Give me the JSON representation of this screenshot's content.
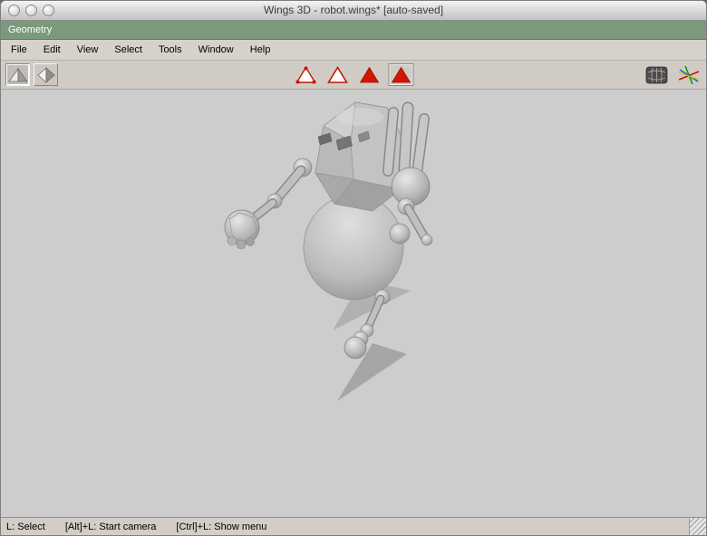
{
  "window": {
    "title": "Wings 3D - robot.wings* [auto-saved]",
    "controls": [
      "close",
      "minimize",
      "zoom"
    ]
  },
  "geometry_bar": {
    "label": "Geometry"
  },
  "menu": {
    "items": [
      "File",
      "Edit",
      "View",
      "Select",
      "Tools",
      "Window",
      "Help"
    ]
  },
  "toolbar": {
    "left_icons": [
      "flat-shaded-cone-icon",
      "smooth-shaded-cone-icon"
    ],
    "selection_icons": [
      "vertex-select-icon",
      "edge-select-icon",
      "face-select-icon",
      "body-select-icon"
    ],
    "active_selection": "body",
    "right_icons": [
      "subdivision-preview-icon",
      "axes-icon"
    ]
  },
  "viewport": {
    "model": "robot"
  },
  "statusbar": {
    "segments": [
      "L: Select",
      "[Alt]+L: Start camera",
      "[Ctrl]+L: Show menu"
    ]
  },
  "colors": {
    "geometry_green": "#7b997b",
    "selection_red": "#c81400",
    "viewport_gray": "#cdcdcd",
    "chrome_gray": "#d0ccc5"
  }
}
